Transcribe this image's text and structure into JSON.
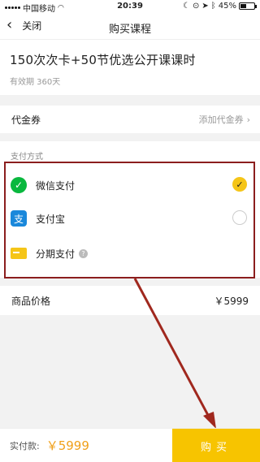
{
  "status_bar": {
    "carrier": "中国移动",
    "time": "20:39",
    "battery": "45%",
    "battery_level": 0.45
  },
  "nav": {
    "back_label": "关闭",
    "title": "购买课程"
  },
  "course": {
    "name": "150次次卡+50节优选公开课课时",
    "validity": "有效期 360天"
  },
  "voucher": {
    "label": "代金券",
    "action": "添加代金券"
  },
  "payment": {
    "section_label": "支付方式",
    "options": [
      {
        "label": "微信支付",
        "icon": "wechat-icon",
        "selected": true
      },
      {
        "label": "支付宝",
        "icon": "alipay-icon",
        "selected": false
      },
      {
        "label": "分期支付",
        "icon": "card-icon",
        "selected": false
      }
    ]
  },
  "price": {
    "label": "商品价格",
    "value": "￥5999"
  },
  "footer": {
    "pay_label": "实付款:",
    "amount": "￥5999",
    "button_label": "购买"
  },
  "colors": {
    "accent": "#f7c400",
    "highlight_border": "#8b1e1e",
    "wechat": "#09b83e",
    "alipay": "#1a88db"
  }
}
